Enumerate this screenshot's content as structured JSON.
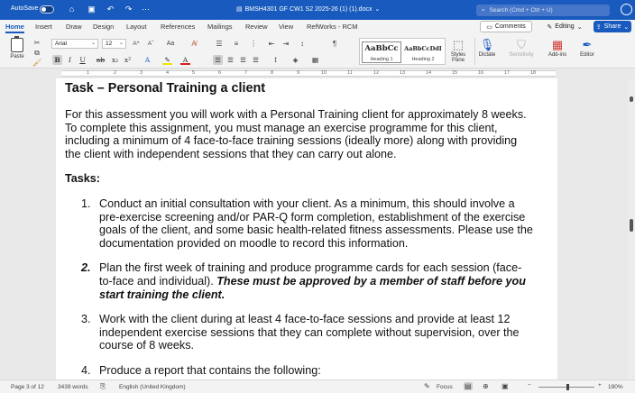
{
  "titlebar": {
    "autosave_label": "AutoSave",
    "doc_title": "BMSH4301 GF CW1 S2 2025-26 (1) (1).docx",
    "search_placeholder": "Search (Cmd + Ctrl + U)"
  },
  "tabs": [
    "Home",
    "Insert",
    "Draw",
    "Design",
    "Layout",
    "References",
    "Mailings",
    "Review",
    "View",
    "RefWorks - RCM"
  ],
  "header_actions": {
    "comments": "Comments",
    "editing": "Editing",
    "share": "Share"
  },
  "ribbon": {
    "paste_label": "Paste",
    "font_name": "Arial",
    "font_size": "12",
    "styles": [
      {
        "sample": "AaBbCc",
        "name": "Heading 1"
      },
      {
        "sample": "AaBbCcDdI",
        "name": "Heading 2"
      }
    ],
    "styles_pane": "Styles Pane",
    "dictate": "Dictate",
    "sensitivity": "Sensitivity",
    "addins": "Add-ins",
    "editor": "Editor"
  },
  "ruler_numbers": [
    "1",
    "2",
    "3",
    "4",
    "5",
    "6",
    "7",
    "8",
    "9",
    "10",
    "11",
    "12",
    "13",
    "14",
    "15",
    "16",
    "17",
    "18"
  ],
  "document": {
    "heading": "Task – Personal Training a client",
    "intro": "For this assessment you will work with a Personal Training client for approximately 8 weeks. To complete this assignment, you must manage an exercise programme for this client, including a minimum of 4 face-to-face training sessions (ideally more) along with providing the client with independent sessions that they can carry out alone.",
    "tasks_heading": "Tasks:",
    "items": [
      {
        "num": "1.",
        "text": "Conduct an initial consultation with your client. As a minimum, this should involve a pre-exercise screening and/or PAR-Q form completion, establishment of the exercise goals of the client, and some basic health-related fitness assessments. Please use the documentation provided on moodle to record this information."
      },
      {
        "num": "2.",
        "text": "Plan the first week of training and produce programme cards for each session (face-to-face and individual). ",
        "emphasis": "These must be approved by a member of staff before you start training the client."
      },
      {
        "num": "3.",
        "text": "Work with the client during at least 4 face-to-face sessions and provide at least 12 independent exercise sessions that they can complete without supervision, over the course of 8 weeks."
      },
      {
        "num": "4.",
        "text": "Produce a report that contains the following:"
      }
    ]
  },
  "statusbar": {
    "page": "Page 3 of 12",
    "words": "3439 words",
    "language": "English (United Kingdom)",
    "focus": "Focus",
    "zoom": "190%"
  }
}
